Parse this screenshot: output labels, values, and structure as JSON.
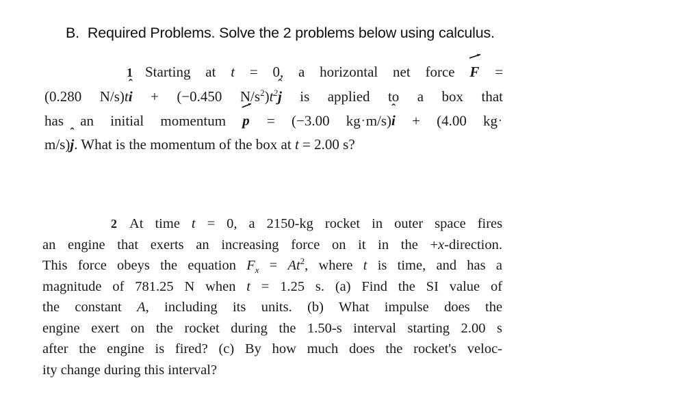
{
  "document": {
    "background_color": "#ffffff",
    "text_color": "#1a1a1a"
  },
  "heading": {
    "letter": "B.",
    "text": "Required Problems. Solve the 2 problems below using calculus."
  },
  "problems": [
    {
      "number": "1",
      "lines": [
        {
          "id": "p1l1",
          "segments": [
            {
              "t": "Starting"
            },
            {
              "t": "at"
            },
            {
              "t": "t",
              "style": "italic"
            },
            {
              "t": "="
            },
            {
              "t": "0,"
            },
            {
              "t": "a"
            },
            {
              "t": "horizontal"
            },
            {
              "t": "net"
            },
            {
              "t": "force"
            },
            {
              "t": "F",
              "style": "vector"
            },
            {
              "t": "="
            }
          ],
          "text": "Starting at t = 0, a horizontal net force F ="
        },
        {
          "id": "p1l2",
          "text": "(0.280 N/s)tî + (−0.450 N/s²)t²ĵ is applied to a box that"
        },
        {
          "id": "p1l3",
          "text": "has an initial momentum p = (−3.00 kg·m/s)î + (4.00 kg·"
        },
        {
          "id": "p1l4",
          "text": "m/s)ĵ. What is the momentum of the box at t = 2.00 s?"
        }
      ],
      "values": {
        "force_i_coefficient": "0.280 N/s",
        "force_j_coefficient": "−0.450 N/s²",
        "momentum_i": "−3.00 kg·m/s",
        "momentum_j": "4.00 kg·m/s",
        "query_time": "2.00 s"
      }
    },
    {
      "number": "2",
      "lines": [
        {
          "id": "p2l1",
          "text": "At time t = 0, a 2150-kg rocket in outer space fires"
        },
        {
          "id": "p2l2",
          "text": "an engine that exerts an increasing force on it in the +x-direction."
        },
        {
          "id": "p2l3",
          "text": "This force obeys the equation Fx = At², where t is time, and has a"
        },
        {
          "id": "p2l4",
          "text": "magnitude of 781.25 N when t = 1.25 s. (a) Find the SI value of"
        },
        {
          "id": "p2l5",
          "text": "the constant A, including its units. (b) What impulse does the"
        },
        {
          "id": "p2l6",
          "text": "engine exert on the rocket during the 1.50-s interval starting 2.00 s"
        },
        {
          "id": "p2l7",
          "text": "after the engine is fired? (c) By how much does the rocket's veloc-"
        },
        {
          "id": "p2l8",
          "text": "ity change during this interval?"
        }
      ],
      "values": {
        "rocket_mass": "2150-kg",
        "direction": "+x-direction",
        "equation": "Fx = At²",
        "force_magnitude": "781.25 N",
        "at_time": "1.25 s",
        "interval_length": "1.50-s",
        "interval_start": "2.00 s"
      }
    }
  ],
  "tokens": {
    "eq": "=",
    "plus": "+",
    "minus": "−",
    "cdot": "·",
    "hat": "^",
    "t": "t",
    "x": "x",
    "A": "A",
    "F": "F",
    "p": "p",
    "i": "i",
    "j": "j",
    "N_per_s": "N/s",
    "N_per_s2": "N/s",
    "kg": "kg",
    "m_per_s": "m/s",
    "s_unit": "s",
    "two": "2",
    "zero": "0",
    "open_paren": "(",
    "close_paren": ")",
    "c0280": "0.280",
    "c0450": "0.450",
    "c300": "3.00",
    "c400": "4.00",
    "c200": "2.00",
    "p1_w_starting": "Starting",
    "p1_w_at": "at",
    "p1_w_comma0": "0,",
    "p1_w_a": "a",
    "p1_w_horizontal": "horizontal",
    "p1_w_net": "net",
    "p1_w_force": "force",
    "p1_w_is": "is",
    "p1_w_applied": "applied",
    "p1_w_to": "to",
    "p1_w_a2": "a",
    "p1_w_box": "box",
    "p1_w_that": "that",
    "p1_w_has": "has",
    "p1_w_an": "an",
    "p1_w_initial": "initial",
    "p1_w_momentum": "momentum",
    "p1_w_period_What": ". What",
    "p1_w_is2": "is",
    "p1_w_the": "the",
    "p1_w_momentum2": "momentum",
    "p1_w_of": "of",
    "p1_w_the2": "the",
    "p1_w_box2": "box",
    "p1_w_at2": "at",
    "p1_w_qmark": "s?",
    "p2_w_At": "At",
    "p2_w_time": "time",
    "p2_w_comma0": "0,",
    "p2_w_a": "a",
    "p2_w_mass": "2150-kg",
    "p2_w_rocket": "rocket",
    "p2_w_in": "in",
    "p2_w_outer": "outer",
    "p2_w_space": "space",
    "p2_w_fires": "fires",
    "p2_l2": "an engine that exerts an increasing force on it in the",
    "p2_l2_dir_sign": "+",
    "p2_l2_dir_tail": "-direction.",
    "p2_l3_a": "This force obeys the equation",
    "p2_l3_where": ", where",
    "p2_l3_tail": "is time, and has a",
    "p2_l4_a": "magnitude of 781.25 N when",
    "p2_l4_eq": "=",
    "p2_l4_tail": "1.25 s. (a) Find the SI value of",
    "p2_l5_a": "the",
    "p2_l5_constant": "constant",
    "p2_l5_A": "A",
    "p2_l5_tail1": ",",
    "p2_l5_including": "including",
    "p2_l5_its": "its",
    "p2_l5_units": "units.",
    "p2_l5_b": "(b)",
    "p2_l5_What": "What",
    "p2_l5_impulse": "impulse",
    "p2_l5_does": "does",
    "p2_l5_the": "the",
    "p2_l6": "engine exert on the rocket during the 1.50-s interval starting 2.00 s",
    "p2_l7": "after the engine is fired? (c) By how much does the rocket's veloc-",
    "p2_l8": "ity change during this interval?"
  }
}
